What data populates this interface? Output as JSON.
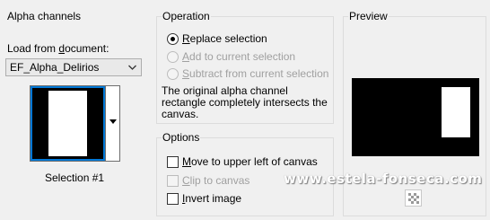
{
  "alpha": {
    "group_title": "Alpha channels",
    "load_label_pre": "Load from ",
    "load_label_u": "d",
    "load_label_post": "ocument:",
    "document_value": "EF_Alpha_Delirios",
    "selection_caption": "Selection #1"
  },
  "operation": {
    "group_title": "Operation",
    "replace_u": "R",
    "replace_rest": "eplace selection",
    "add_u": "A",
    "add_rest": "dd to current selection",
    "subtract_u": "S",
    "subtract_rest": "ubtract from current selection",
    "selected": "replace",
    "description": "The original alpha channel rectangle completely intersects the canvas."
  },
  "options": {
    "group_title": "Options",
    "move_u": "M",
    "move_rest": "ove to upper left of canvas",
    "move_checked": false,
    "clip_u": "C",
    "clip_rest": "lip to canvas",
    "clip_checked": false,
    "invert_u": "I",
    "invert_rest": "nvert image",
    "invert_checked": false
  },
  "preview": {
    "group_title": "Preview"
  },
  "watermark": {
    "text": "www.estela-fonseca.com"
  },
  "colors": {
    "dialog_bg": "#f0f0f0",
    "selection_border": "#0078d7",
    "disabled_text": "#a0a0a0"
  }
}
